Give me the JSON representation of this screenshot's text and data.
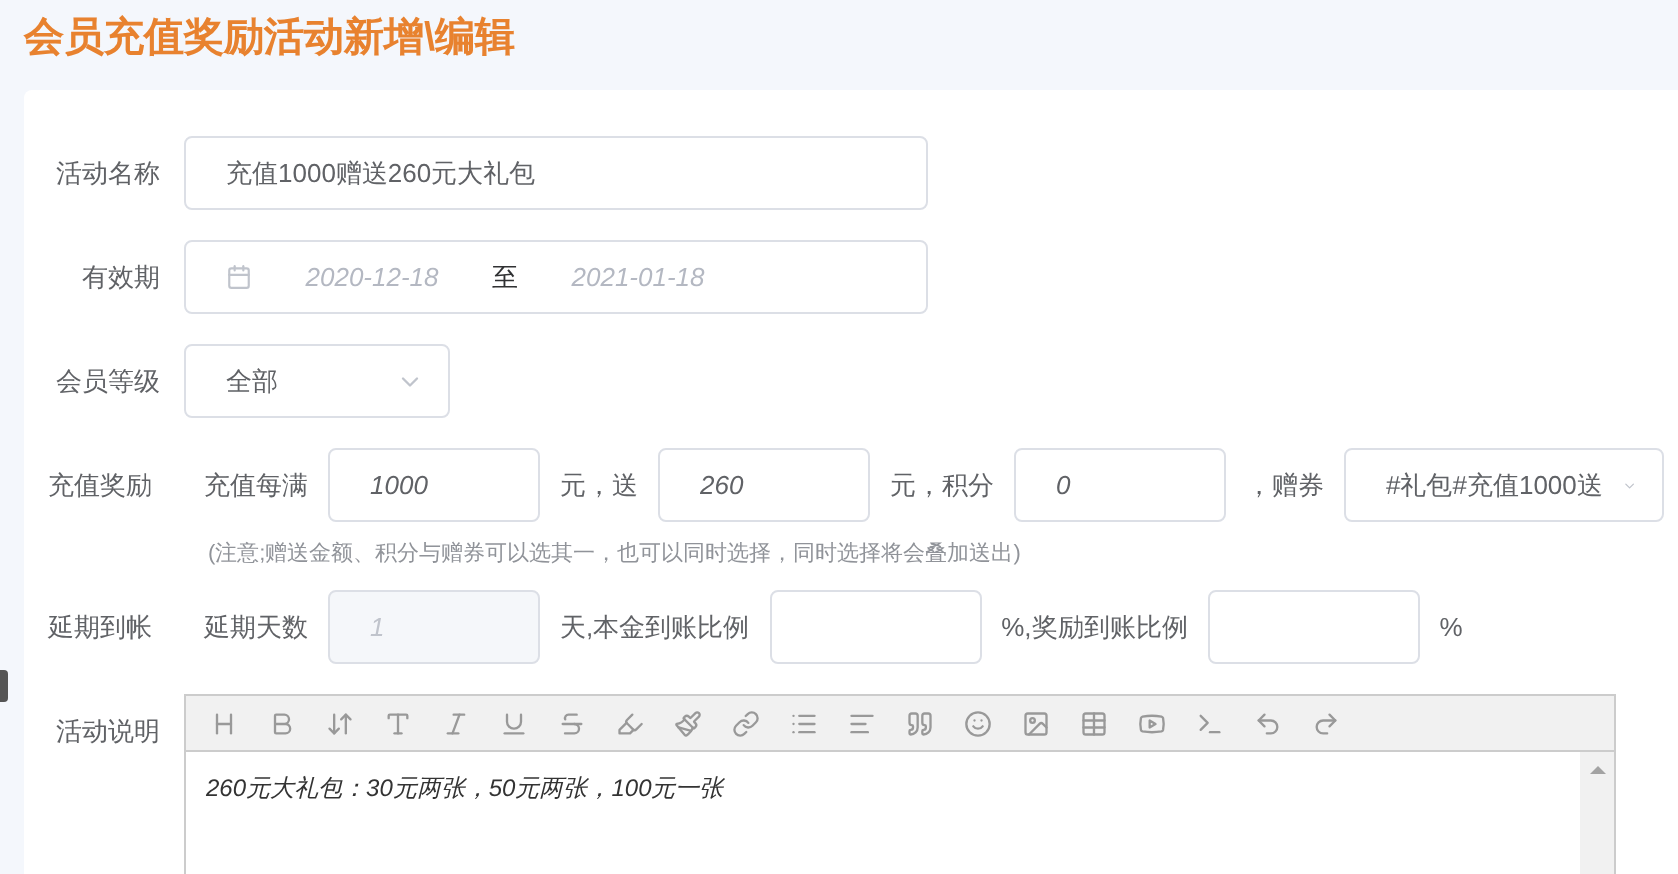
{
  "page_title": "会员充值奖励活动新增\\编辑",
  "activity_name": {
    "label": "活动名称",
    "value": "充值1000赠送260元大礼包"
  },
  "validity": {
    "label": "有效期",
    "start": "2020-12-18",
    "separator": "至",
    "end": "2021-01-18"
  },
  "member_level": {
    "label": "会员等级",
    "value": "全部"
  },
  "reward": {
    "label": "充值奖励",
    "parts": [
      {
        "kind": "text",
        "text": "充值每满"
      },
      {
        "kind": "input",
        "value": "1000",
        "disabled": false
      },
      {
        "kind": "text",
        "text": "元，送"
      },
      {
        "kind": "input",
        "value": "260",
        "disabled": false
      },
      {
        "kind": "text",
        "text": "元，积分"
      },
      {
        "kind": "input",
        "value": "0",
        "disabled": false
      },
      {
        "kind": "text",
        "text": "，赠券"
      },
      {
        "kind": "select",
        "value": "#礼包#充值1000送"
      }
    ],
    "note": "(注意;赠送金额、积分与赠券可以选其一，也可以同时选择，同时选择将会叠加送出)"
  },
  "delay": {
    "label": "延期到帐",
    "parts": [
      {
        "kind": "text",
        "text": "延期天数"
      },
      {
        "kind": "input",
        "value": "1",
        "disabled": true
      },
      {
        "kind": "text",
        "text": "天,本金到账比例"
      },
      {
        "kind": "input"
      },
      {
        "kind": "text",
        "text": "%,奖励到账比例"
      },
      {
        "kind": "input"
      },
      {
        "kind": "text",
        "text": "%"
      }
    ]
  },
  "description": {
    "label": "活动说明",
    "content": "260元大礼包：30元两张，50元两张，100元一张"
  }
}
